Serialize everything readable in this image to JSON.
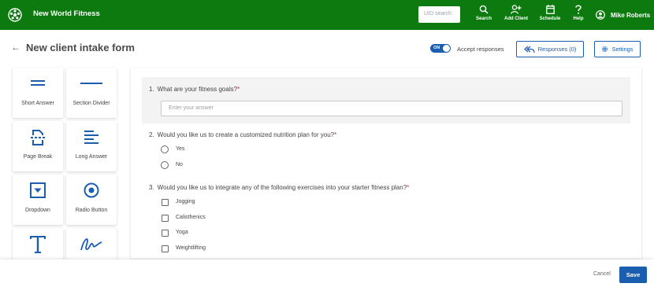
{
  "header": {
    "app_title": "New World Fitness",
    "search_placeholder": "UID search",
    "nav": [
      {
        "label": "Search",
        "icon": "search-icon"
      },
      {
        "label": "Add Client",
        "icon": "add-user-icon"
      },
      {
        "label": "Schedule",
        "icon": "calendar-icon"
      },
      {
        "label": "Help",
        "icon": "help-icon"
      }
    ],
    "user_name": "Mike Roberts"
  },
  "page": {
    "back_icon": "←",
    "title": "New client intake form",
    "toggle_text": "ON",
    "accept_label": "Accept responses",
    "responses_label": "Responses (0)",
    "settings_label": "Settings"
  },
  "palette": [
    {
      "label": "Short Answer",
      "icon": "short-answer-icon"
    },
    {
      "label": "Section Divider",
      "icon": "section-divider-icon"
    },
    {
      "label": "Page Break",
      "icon": "page-break-icon"
    },
    {
      "label": "Long Answer",
      "icon": "long-answer-icon"
    },
    {
      "label": "Dropdown",
      "icon": "dropdown-icon"
    },
    {
      "label": "Radio Button",
      "icon": "radio-button-icon"
    },
    {
      "label": "",
      "icon": "text-icon"
    },
    {
      "label": "",
      "icon": "signature-icon"
    }
  ],
  "questions": [
    {
      "number": "1.",
      "text": "What are your fitness goals?",
      "required": "*",
      "placeholder": "Enter your answer"
    },
    {
      "number": "2.",
      "text": "Would you like us to create a customized nutrition plan for you?",
      "required": "*",
      "options": [
        "Yes",
        "No"
      ]
    },
    {
      "number": "3.",
      "text": "Would you like us to integrate any of the following exercises into your starter fitness plan?",
      "required": "*",
      "options": [
        "Jogging",
        "Calisthenics",
        "Yoga",
        "Weightlifting"
      ]
    }
  ],
  "footer": {
    "cancel_label": "Cancel",
    "save_label": "Save"
  },
  "colors": {
    "brand_green": "#0d7a10",
    "accent_blue": "#1b5eb0",
    "required_red": "#d32f2f"
  }
}
